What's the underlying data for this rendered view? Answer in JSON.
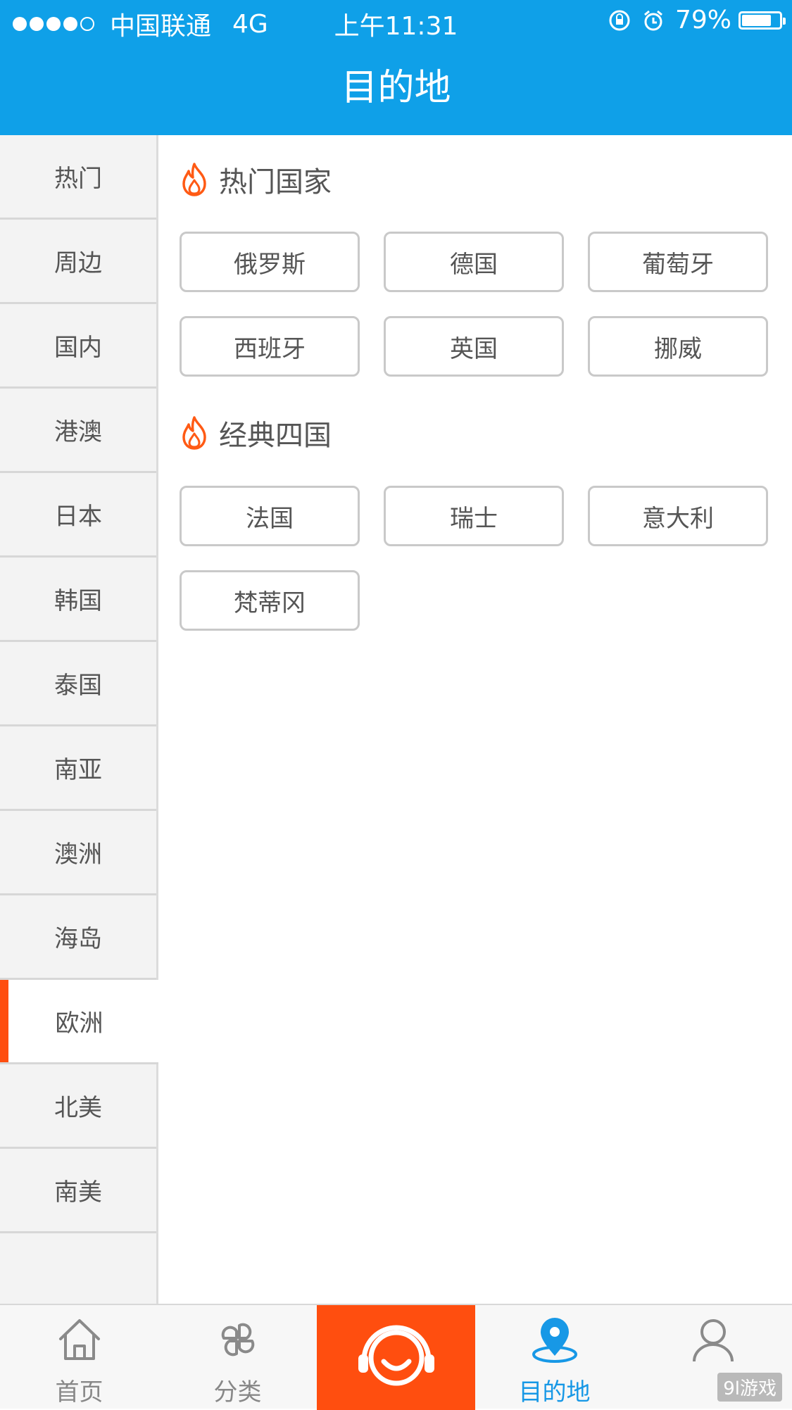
{
  "status_bar": {
    "carrier": "中国联通",
    "network": "4G",
    "time": "上午11:31",
    "battery": "79%",
    "battery_level": 0.79
  },
  "header": {
    "title": "目的地"
  },
  "sidebar": {
    "items": [
      {
        "label": "热门"
      },
      {
        "label": "周边"
      },
      {
        "label": "国内"
      },
      {
        "label": "港澳"
      },
      {
        "label": "日本"
      },
      {
        "label": "韩国"
      },
      {
        "label": "泰国"
      },
      {
        "label": "南亚"
      },
      {
        "label": "澳洲"
      },
      {
        "label": "海岛"
      },
      {
        "label": "欧洲",
        "selected": true
      },
      {
        "label": "北美"
      },
      {
        "label": "南美"
      }
    ]
  },
  "sections": [
    {
      "title": "热门国家",
      "icon": "fire-icon",
      "countries": [
        "俄罗斯",
        "德国",
        "葡萄牙",
        "西班牙",
        "英国",
        "挪威"
      ]
    },
    {
      "title": "经典四国",
      "icon": "fire-icon",
      "countries": [
        "法国",
        "瑞士",
        "意大利",
        "梵蒂冈"
      ]
    }
  ],
  "tabbar": {
    "tabs": [
      {
        "label": "首页",
        "icon": "home-icon"
      },
      {
        "label": "分类",
        "icon": "grid-icon"
      },
      {
        "label": "",
        "icon": "customer-service-icon"
      },
      {
        "label": "目的地",
        "icon": "location-pin-icon",
        "active": true
      },
      {
        "label": "",
        "icon": "user-icon"
      }
    ]
  },
  "watermark": "9l游戏",
  "colors": {
    "primary": "#0fa0e8",
    "accent": "#ff4e0f",
    "active_tab": "#1798e6"
  }
}
